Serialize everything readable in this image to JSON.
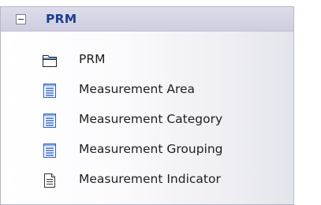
{
  "group": {
    "title": "PRM",
    "expanded": true
  },
  "items": [
    {
      "label": "PRM",
      "icon": "package-folder-icon"
    },
    {
      "label": "Measurement Area",
      "icon": "list-document-icon"
    },
    {
      "label": "Measurement Category",
      "icon": "list-document-icon"
    },
    {
      "label": "Measurement Grouping",
      "icon": "list-document-icon"
    },
    {
      "label": "Measurement Indicator",
      "icon": "page-document-icon"
    }
  ]
}
